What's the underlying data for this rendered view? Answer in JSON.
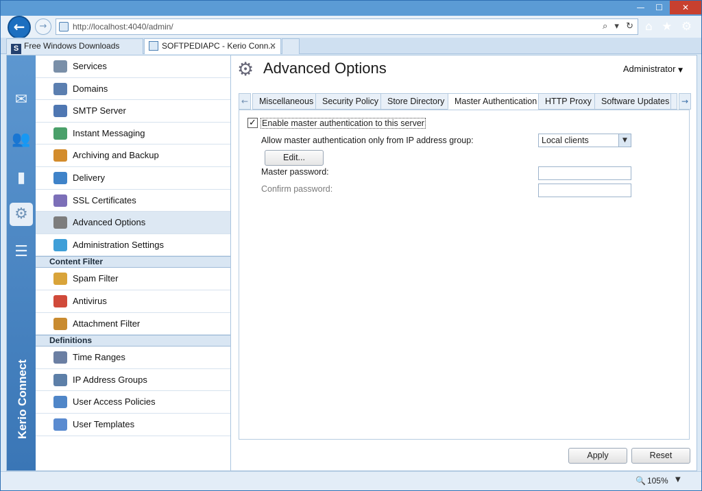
{
  "browser": {
    "address": "http://localhost:4040/admin/",
    "address_host": "localhost",
    "tabs": [
      {
        "label": "Free Windows Downloads"
      },
      {
        "label": "SOFTPEDIAPC - Kerio Conn..."
      }
    ],
    "zoom": "105%"
  },
  "rail": {
    "brand": "Kerio Connect"
  },
  "nav": {
    "items_top": [
      {
        "label": "Services",
        "color": "#7a8fa8"
      },
      {
        "label": "Domains",
        "color": "#5b7fb0"
      },
      {
        "label": "SMTP Server",
        "color": "#4f77b2"
      },
      {
        "label": "Instant Messaging",
        "color": "#4aa06a"
      },
      {
        "label": "Archiving and Backup",
        "color": "#d38c2c"
      },
      {
        "label": "Delivery",
        "color": "#3f83c9"
      },
      {
        "label": "SSL Certificates",
        "color": "#7c6fb8"
      },
      {
        "label": "Advanced Options",
        "color": "#7d7d7d"
      },
      {
        "label": "Administration Settings",
        "color": "#3f9fd8"
      }
    ],
    "header_content": "Content Filter",
    "items_content": [
      {
        "label": "Spam Filter",
        "color": "#d9a43a"
      },
      {
        "label": "Antivirus",
        "color": "#d04a3a"
      },
      {
        "label": "Attachment Filter",
        "color": "#c98b30"
      }
    ],
    "header_defs": "Definitions",
    "items_defs": [
      {
        "label": "Time Ranges",
        "color": "#6b7fa3"
      },
      {
        "label": "IP Address Groups",
        "color": "#5d7fa8"
      },
      {
        "label": "User Access Policies",
        "color": "#4f86c8"
      },
      {
        "label": "User Templates",
        "color": "#5a8bd0"
      }
    ]
  },
  "main": {
    "title": "Advanced Options",
    "user": "Administrator",
    "tabs": [
      {
        "label": "Miscellaneous"
      },
      {
        "label": "Security Policy"
      },
      {
        "label": "Store Directory"
      },
      {
        "label": "Master Authentication"
      },
      {
        "label": "HTTP Proxy"
      },
      {
        "label": "Software Updates"
      }
    ],
    "form": {
      "enable_label": "Enable master authentication to this server",
      "enable_checked": true,
      "allow_label": "Allow master authentication only from IP address group:",
      "ip_group_value": "Local clients",
      "edit_label": "Edit...",
      "password_label": "Master password:",
      "confirm_label": "Confirm password:"
    },
    "apply_label": "Apply",
    "reset_label": "Reset"
  }
}
